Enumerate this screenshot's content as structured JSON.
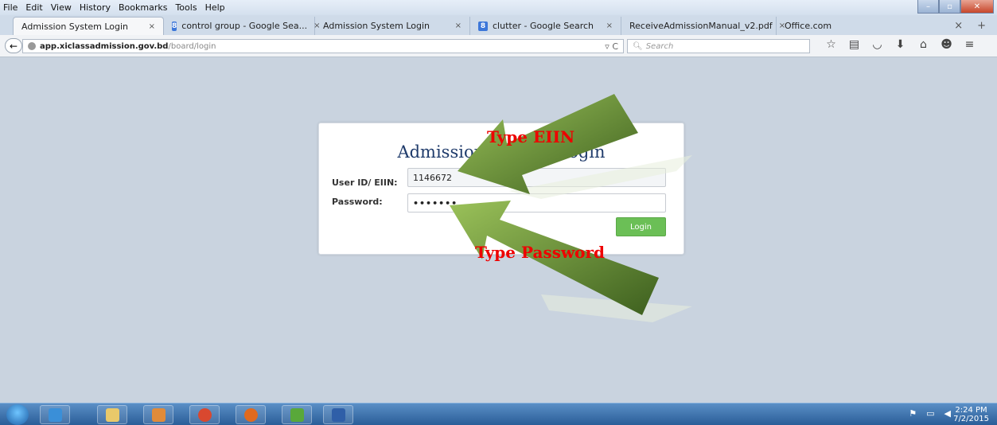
{
  "menu": [
    "File",
    "Edit",
    "View",
    "History",
    "Bookmarks",
    "Tools",
    "Help"
  ],
  "window_controls": {
    "minimize": "–",
    "maximize": "▫",
    "close": "✕"
  },
  "tabs": [
    {
      "label": "Admission System Login",
      "icon": "",
      "close": "×"
    },
    {
      "label": "control group - Google Sea...",
      "icon": "8",
      "close": "×"
    },
    {
      "label": "Admission System Login",
      "icon": "",
      "close": "×"
    },
    {
      "label": "clutter - Google Search",
      "icon": "8",
      "close": "×"
    },
    {
      "label": "ReceiveAdmissionManual_v2.pdf",
      "icon": "",
      "close": "×"
    },
    {
      "label": "Office.com",
      "icon": "",
      "close": ""
    }
  ],
  "tab_tools": {
    "close": "×",
    "new_tab": "+"
  },
  "nav": {
    "back": "←",
    "url_host": "app.xiclassadmission.gov.bd",
    "url_path": "/board/login",
    "reload": "▿ C",
    "search_placeholder": "Search",
    "search_glyph": "🔍︎",
    "icons": [
      "☆",
      "▤",
      "◡",
      "⬇",
      "⌂",
      "☻",
      "≡"
    ]
  },
  "login": {
    "title": "Admission System Login",
    "user_label": "User ID/ EIIN:",
    "user_value": "1146672",
    "password_label": "Password:",
    "password_value": "•••••••",
    "button": "Login"
  },
  "annotations": {
    "top": "Type EIIN",
    "bottom": "Type Password",
    "arrow_color": "#5e8a2a"
  },
  "taskbar": {
    "apps": [
      "ie-icon",
      "explorer-icon",
      "media-icon",
      "chrome-icon",
      "firefox-icon",
      "frog-icon",
      "word-icon"
    ],
    "tray": [
      "⚑",
      "▭",
      "◀"
    ],
    "time": "2:24 PM",
    "date": "7/2/2015"
  }
}
